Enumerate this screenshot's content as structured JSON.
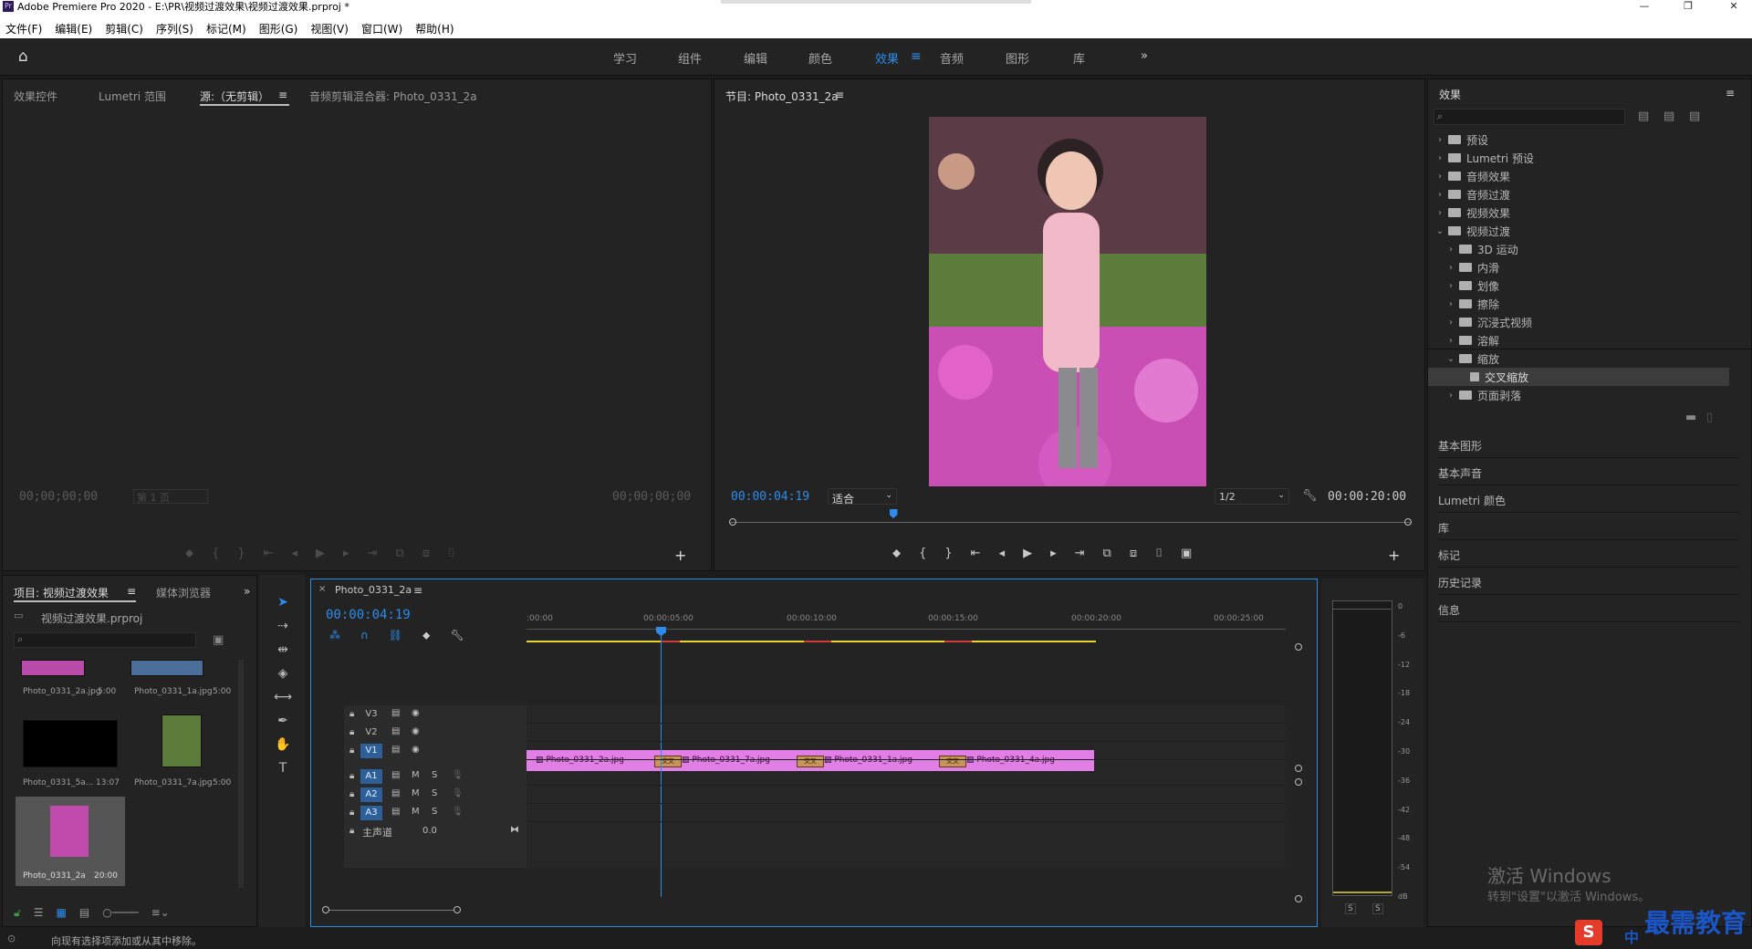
{
  "window": {
    "title": "Adobe Premiere Pro 2020 - E:\\PR\\视频过渡效果\\视频过渡效果.prproj *",
    "app_badge": "Pr"
  },
  "menu": [
    "文件(F)",
    "编辑(E)",
    "剪辑(C)",
    "序列(S)",
    "标记(M)",
    "图形(G)",
    "视图(V)",
    "窗口(W)",
    "帮助(H)"
  ],
  "workspaces": [
    "学习",
    "组件",
    "编辑",
    "颜色",
    "效果",
    "音频",
    "图形",
    "库"
  ],
  "active_workspace": "效果",
  "source_panel": {
    "tabs": [
      "效果控件",
      "Lumetri 范围",
      "源:（无剪辑）",
      "音频剪辑混合器: Photo_0331_2a"
    ],
    "timecode_left": "00;00;00;00",
    "page": "第 1 页",
    "timecode_right": "00;00;00;00"
  },
  "program_monitor": {
    "tab": "节目: Photo_0331_2a",
    "timecode": "00:00:04:19",
    "fit": "适合",
    "resolution": "1/2",
    "duration": "00:00:20:00",
    "playhead_fraction": 0.24
  },
  "effects_panel": {
    "title": "效果",
    "search_placeholder": "",
    "tree": [
      {
        "label": "预设",
        "level": 0,
        "expanded": false
      },
      {
        "label": "Lumetri 预设",
        "level": 0,
        "expanded": false
      },
      {
        "label": "音频效果",
        "level": 0,
        "expanded": false
      },
      {
        "label": "音频过渡",
        "level": 0,
        "expanded": false
      },
      {
        "label": "视频效果",
        "level": 0,
        "expanded": false
      },
      {
        "label": "视频过渡",
        "level": 0,
        "expanded": true
      },
      {
        "label": "3D 运动",
        "level": 1,
        "expanded": false
      },
      {
        "label": "内滑",
        "level": 1,
        "expanded": false
      },
      {
        "label": "划像",
        "level": 1,
        "expanded": false
      },
      {
        "label": "擦除",
        "level": 1,
        "expanded": false
      },
      {
        "label": "沉浸式视频",
        "level": 1,
        "expanded": false
      },
      {
        "label": "溶解",
        "level": 1,
        "expanded": false
      },
      {
        "label": "缩放",
        "level": 1,
        "expanded": true
      },
      {
        "label": "交叉缩放",
        "level": 2,
        "expanded": false
      },
      {
        "label": "页面剥落",
        "level": 1,
        "expanded": false
      }
    ],
    "selected": "交叉缩放",
    "lower_panels": [
      "基本图形",
      "基本声音",
      "Lumetri 颜色",
      "库",
      "标记",
      "历史记录",
      "信息"
    ]
  },
  "project_panel": {
    "tabs": [
      "项目: 视频过渡效果",
      "媒体浏览器"
    ],
    "file": "视频过渡效果.prproj",
    "items": [
      {
        "name": "Photo_0331_2a.jpg",
        "duration": "5:00"
      },
      {
        "name": "Photo_0331_1a.jpg",
        "duration": "5:00"
      },
      {
        "name": "Photo_0331_5a...",
        "duration": "13:07"
      },
      {
        "name": "Photo_0331_7a.jpg",
        "duration": "5:00"
      },
      {
        "name": "Photo_0331_2a",
        "duration": "20:00"
      }
    ]
  },
  "timeline": {
    "tab": "Photo_0331_2a",
    "timecode": "00:00:04:19",
    "ruler": [
      ":00:00",
      "00:00:05:00",
      "00:00:10:00",
      "00:00:15:00",
      "00:00:20:00",
      "00:00:25:00"
    ],
    "tracks": [
      {
        "name": "V3",
        "kind": "video"
      },
      {
        "name": "V2",
        "kind": "video"
      },
      {
        "name": "V1",
        "kind": "video"
      },
      {
        "name": "A1",
        "kind": "audio"
      },
      {
        "name": "A2",
        "kind": "audio"
      },
      {
        "name": "A3",
        "kind": "audio"
      }
    ],
    "master": {
      "label": "主声道",
      "value": "0.0"
    },
    "mute_letter": "M",
    "solo_letter": "S",
    "clips": [
      "Photo_0331_2a.jpg",
      "Photo_0331_7a.jpg",
      "Photo_0331_1a.jpg",
      "Photo_0331_4a.jpg"
    ],
    "transition_label": "交叉"
  },
  "audio_meter": {
    "scale": [
      "0",
      "-6",
      "-12",
      "-18",
      "-24",
      "-30",
      "-36",
      "-42",
      "-48",
      "-54",
      "dB"
    ],
    "solo": [
      "S",
      "S"
    ]
  },
  "status_bar": "向现有选择项添加或从其中移除。",
  "watermark": {
    "line1": "激活 Windows",
    "line2": "转到\"设置\"以激活 Windows。"
  },
  "logo": "最需教育",
  "ime": "中"
}
